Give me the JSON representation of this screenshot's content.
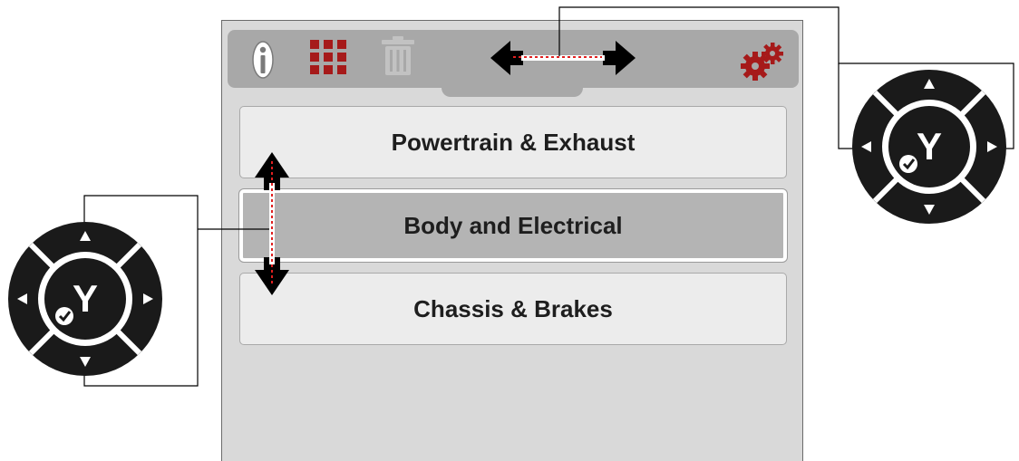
{
  "toolbar": {
    "icons": [
      "info-icon",
      "grid-icon",
      "trash-icon",
      "left-right-arrows-icon",
      "settings-gears-icon"
    ]
  },
  "menu": {
    "items": [
      {
        "label": "Powertrain & Exhaust",
        "selected": false
      },
      {
        "label": "Body and Electrical",
        "selected": true
      },
      {
        "label": "Chassis & Brakes",
        "selected": false
      }
    ]
  },
  "controllers": {
    "left": {
      "center_label": "Y"
    },
    "right": {
      "center_label": "Y"
    }
  },
  "colors": {
    "screen_bg": "#d9d9d9",
    "toolbar_bg": "#a8a8a8",
    "item_bg": "#ececec",
    "item_selected_bg": "#b4b4b4",
    "accent_red": "#a61a1a",
    "dpad_dark": "#1a1a1a"
  }
}
